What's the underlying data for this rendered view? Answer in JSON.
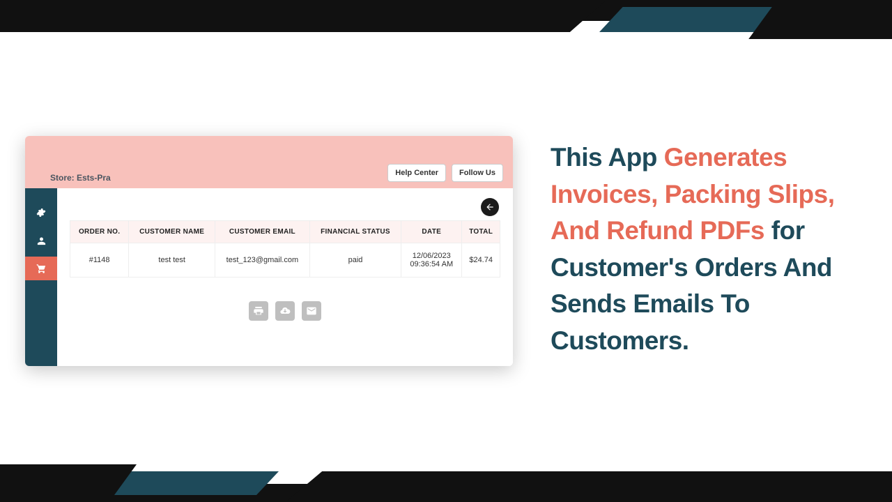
{
  "hero": {
    "p1": "This App ",
    "hl": "Generates Invoices, Packing Slips, And Refund PDFs ",
    "p2": "for Customer's Orders And Sends Emails To Customers."
  },
  "header": {
    "store_label": "Store: Ests-Pra",
    "help_center": "Help Center",
    "follow_us": "Follow Us"
  },
  "table": {
    "headers": {
      "order_no": "ORDER NO.",
      "customer_name": "CUSTOMER NAME",
      "customer_email": "CUSTOMER EMAIL",
      "financial_status": "FINANCIAL STATUS",
      "date": "DATE",
      "total": "TOTAL"
    },
    "row": {
      "order_no": "#1148",
      "customer_name": "test test",
      "customer_email": "test_123@gmail.com",
      "financial_status": "paid",
      "date_line1": "12/06/2023",
      "date_line2": "09:36:54 AM",
      "total": "$24.74"
    }
  }
}
